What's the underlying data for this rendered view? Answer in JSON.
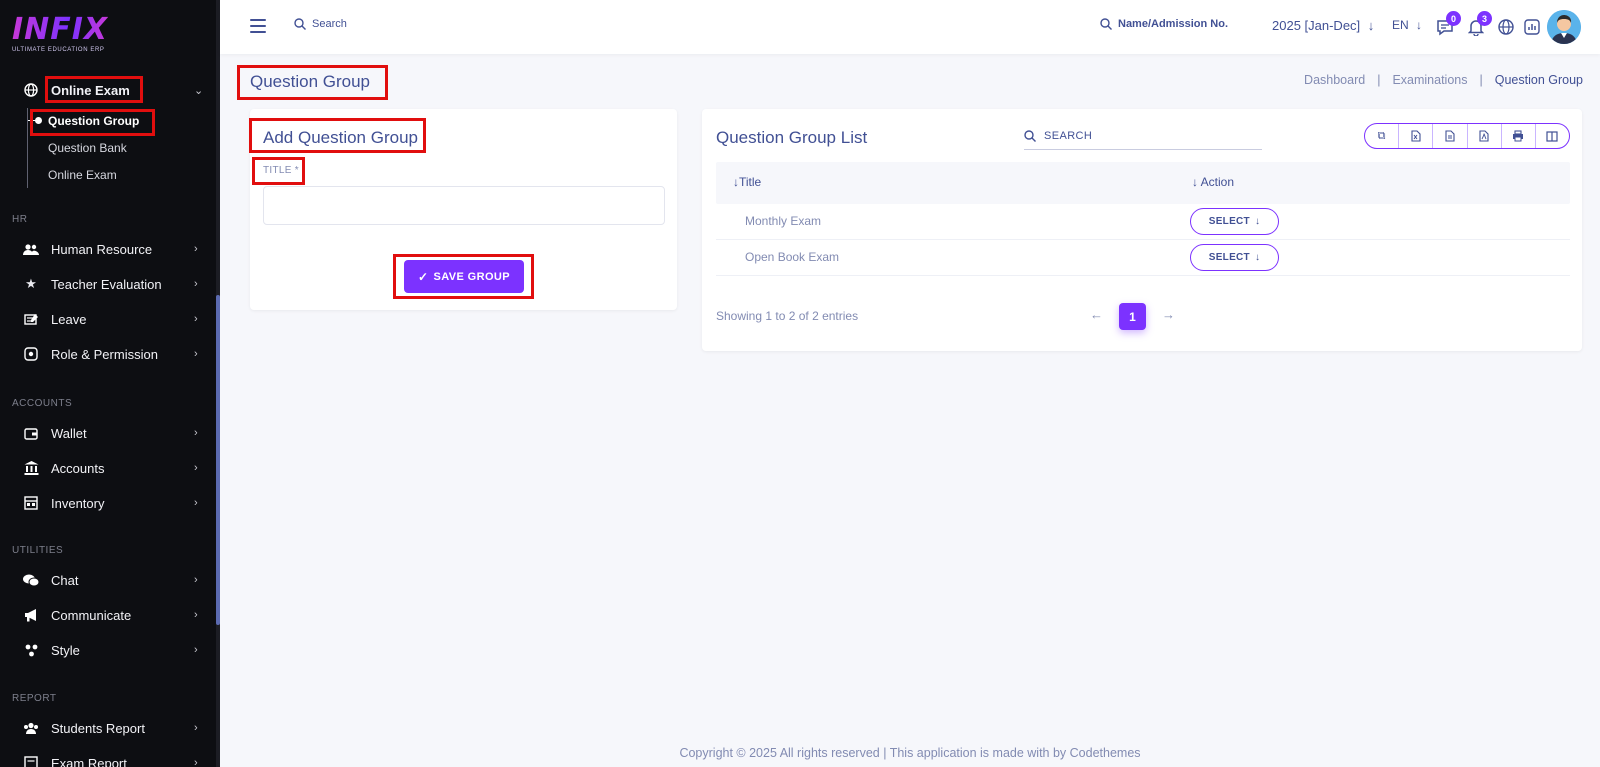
{
  "logo": {
    "word": "INFIX",
    "sub": "ULTIMATE EDUCATION ERP"
  },
  "sidebar": {
    "online_exam": "Online Exam",
    "sub_items": [
      "Question Group",
      "Question Bank",
      "Online Exam"
    ],
    "section_hr": "HR",
    "hr_items": [
      "Human Resource",
      "Teacher Evaluation",
      "Leave",
      "Role & Permission"
    ],
    "section_accounts": "ACCOUNTS",
    "accounts_items": [
      "Wallet",
      "Accounts",
      "Inventory"
    ],
    "section_utilities": "UTILITIES",
    "utilities_items": [
      "Chat",
      "Communicate",
      "Style"
    ],
    "section_report": "REPORT",
    "report_items": [
      "Students Report",
      "Exam Report"
    ]
  },
  "topbar": {
    "search_placeholder": "Search",
    "admission_placeholder": "Name/Admission No.",
    "year": "2025 [Jan-Dec]",
    "lang": "EN",
    "messages_count": "0",
    "notifications_count": "3"
  },
  "page": {
    "title": "Question Group",
    "breadcrumb": [
      "Dashboard",
      "Examinations",
      "Question Group"
    ]
  },
  "add_form": {
    "title": "Add Question Group",
    "field_label": "TITLE *",
    "field_value": "",
    "save_label": "SAVE GROUP"
  },
  "list": {
    "title": "Question Group List",
    "search_label": "SEARCH",
    "columns": [
      "Title",
      "Action"
    ],
    "rows": [
      {
        "title": "Monthly Exam",
        "action": "SELECT"
      },
      {
        "title": "Open Book Exam",
        "action": "SELECT"
      }
    ],
    "entries_text": "Showing 1 to 2 of 2 entries",
    "current_page": "1"
  },
  "footer": {
    "text": "Copyright © 2025 All rights reserved | This application is made with by Codethemes"
  },
  "colors": {
    "accent": "#7c32ff",
    "text": "#415094",
    "muted": "#828bb2",
    "sidebar": "#0d0e12",
    "highlight": "#e10e0e"
  }
}
